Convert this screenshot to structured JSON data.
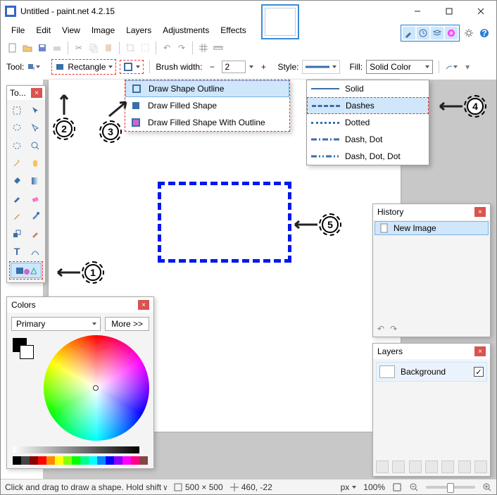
{
  "title": "Untitled - paint.net 4.2.15",
  "menu": {
    "file": "File",
    "edit": "Edit",
    "view": "View",
    "image": "Image",
    "layers": "Layers",
    "adjustments": "Adjustments",
    "effects": "Effects"
  },
  "toolbar2": {
    "tool_label": "Tool:",
    "shape": "Rectangle",
    "brush_label": "Brush width:",
    "brush_value": "2",
    "style_label": "Style:",
    "fill_label": "Fill:",
    "fill_value": "Solid Color"
  },
  "shape_menu": {
    "items": [
      {
        "label": "Draw Shape Outline",
        "hl": true
      },
      {
        "label": "Draw Filled Shape",
        "hl": false
      },
      {
        "label": "Draw Filled Shape With Outline",
        "hl": false
      }
    ]
  },
  "style_menu": {
    "items": [
      {
        "label": "Solid",
        "kind": "solid",
        "hl": false
      },
      {
        "label": "Dashes",
        "kind": "dash",
        "hl": true
      },
      {
        "label": "Dotted",
        "kind": "dot",
        "hl": false
      },
      {
        "label": "Dash, Dot",
        "kind": "dashdot",
        "hl": false
      },
      {
        "label": "Dash, Dot, Dot",
        "kind": "dashdotdot",
        "hl": false
      }
    ]
  },
  "colors": {
    "title": "Colors",
    "primary": "Primary",
    "more": "More >>"
  },
  "history": {
    "title": "History",
    "item": "New Image"
  },
  "layers": {
    "title": "Layers",
    "item": "Background"
  },
  "tools_win": {
    "title": "To..."
  },
  "status": {
    "hint": "Click and drag to draw a shape. Hold shift while drawing to...",
    "canvas_size": "500 × 500",
    "cursor": "460, -22",
    "units": "px",
    "zoom": "100%"
  },
  "annotations": {
    "1": "1",
    "2": "2",
    "3": "3",
    "4": "4",
    "5": "5"
  },
  "palette": [
    "#000",
    "#444",
    "#800",
    "#f00",
    "#f80",
    "#ff0",
    "#8f0",
    "#0f0",
    "#0f8",
    "#0ff",
    "#08f",
    "#00f",
    "#80f",
    "#f0f",
    "#f08",
    "#844"
  ]
}
